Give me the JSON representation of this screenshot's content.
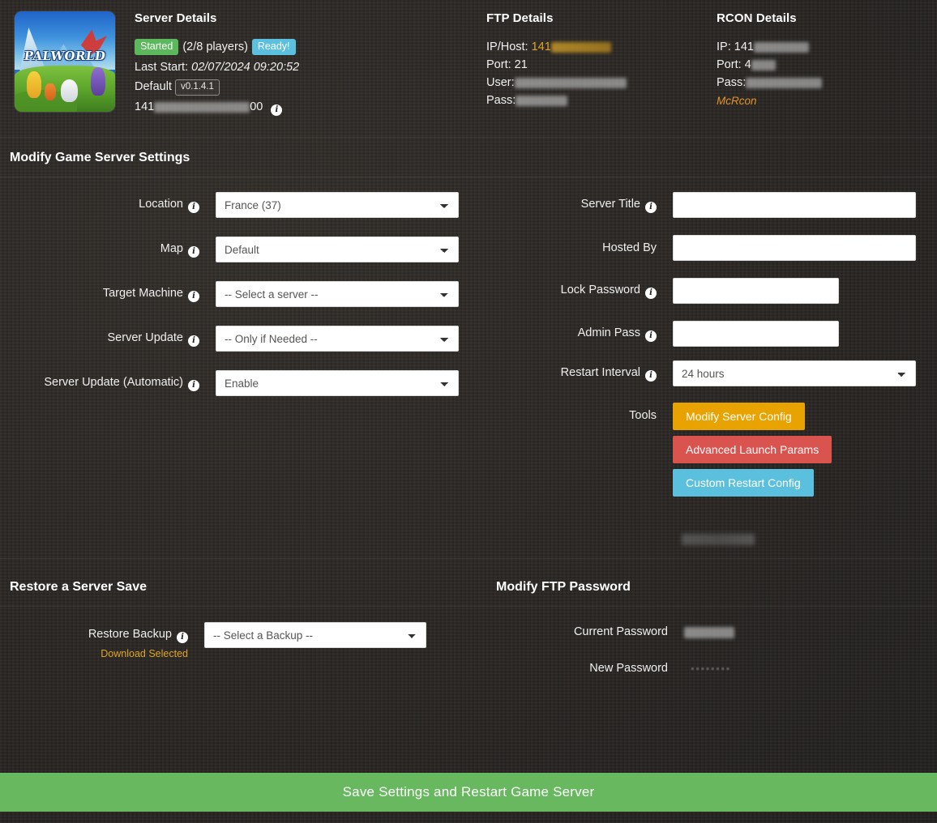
{
  "server_details": {
    "heading": "Server Details",
    "status_badge": "Started",
    "players": "(2/8 players)",
    "ready_badge": "Ready!",
    "last_start_label": "Last Start:",
    "last_start_value": "02/07/2024 09:20:52",
    "default_label": "Default",
    "version_badge": "v0.1.4.1",
    "address_prefix": "141",
    "address_suffix": "00",
    "thumbnail_title": "PALWORLD",
    "status_color": "#5cb85c",
    "ready_color": "#5bc0de"
  },
  "ftp_details": {
    "heading": "FTP Details",
    "ip_label": "IP/Host:",
    "ip_value": "141",
    "port_label": "Port:",
    "port_value": "21",
    "user_label": "User:",
    "pass_label": "Pass:"
  },
  "rcon_details": {
    "heading": "RCON Details",
    "ip_label": "IP:",
    "ip_value": "141",
    "port_label": "Port:",
    "port_value": "4",
    "pass_label": "Pass:",
    "tool_link": "McRcon",
    "link_color": "#e0922a"
  },
  "settings": {
    "title": "Modify Game Server Settings",
    "left_fields": [
      {
        "label": "Location",
        "value": "France (37)",
        "has_info": true
      },
      {
        "label": "Map",
        "value": "Default",
        "has_info": true
      },
      {
        "label": "Target Machine",
        "value": "-- Select a server --",
        "has_info": true
      },
      {
        "label": "Server Update",
        "value": "-- Only if Needed --",
        "has_info": true
      },
      {
        "label": "Server Update (Automatic)",
        "value": "Enable",
        "has_info": true
      }
    ],
    "right_fields": [
      {
        "label": "Server Title",
        "has_info": true,
        "type": "text",
        "redacted": true
      },
      {
        "label": "Hosted By",
        "has_info": false,
        "type": "text",
        "redacted": true
      },
      {
        "label": "Lock Password",
        "has_info": true,
        "type": "text",
        "redacted": false
      },
      {
        "label": "Admin Pass",
        "has_info": true,
        "type": "text",
        "redacted": true
      },
      {
        "label": "Restart Interval",
        "has_info": true,
        "type": "select",
        "value": "24 hours"
      }
    ],
    "tools_label": "Tools",
    "tools": [
      {
        "label": "Modify Server Config",
        "color": "#e8a300"
      },
      {
        "label": "Advanced Launch Params",
        "color": "#d9534f"
      },
      {
        "label": "Custom Restart Config",
        "color": "#5bc0de"
      }
    ]
  },
  "restore": {
    "title": "Restore a Server Save",
    "field_label": "Restore Backup",
    "select_value": "-- Select a Backup --",
    "download_link": "Download Selected"
  },
  "ftp_password": {
    "title": "Modify FTP Password",
    "current_label": "Current Password",
    "new_label": "New Password",
    "new_value": "••••••••"
  },
  "save_button": {
    "label": "Save Settings and Restart Game Server",
    "color": "#68b860"
  }
}
